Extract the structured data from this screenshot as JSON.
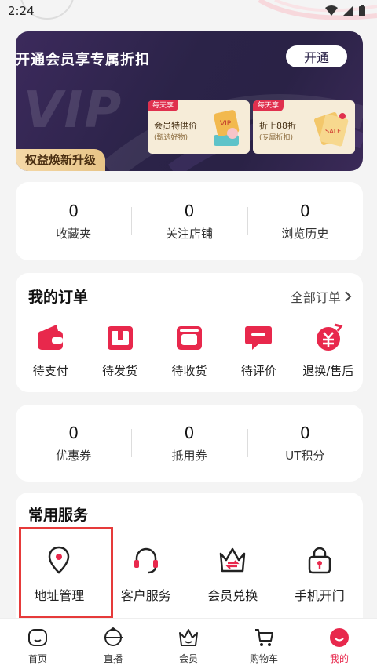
{
  "status_bar": {
    "time": "2:24"
  },
  "vip": {
    "title": "开通会员享专属折扣",
    "open_button": "开通",
    "watermark": "VIP",
    "benefits": [
      {
        "tag": "每天享",
        "main": "会员特供价",
        "sub": "(甄选好物)"
      },
      {
        "tag": "每天享",
        "main": "折上88折",
        "sub": "(专属折扣)"
      }
    ],
    "upgrade_label": "权益焕新升级"
  },
  "stats_top": [
    {
      "value": "0",
      "label": "收藏夹"
    },
    {
      "value": "0",
      "label": "关注店铺"
    },
    {
      "value": "0",
      "label": "浏览历史"
    }
  ],
  "orders": {
    "title": "我的订单",
    "all_label": "全部订单",
    "items": [
      {
        "label": "待支付",
        "icon": "wallet-icon"
      },
      {
        "label": "待发货",
        "icon": "box-icon"
      },
      {
        "label": "待收货",
        "icon": "package-icon"
      },
      {
        "label": "待评价",
        "icon": "comment-icon"
      },
      {
        "label": "退换/售后",
        "icon": "refund-icon"
      }
    ]
  },
  "stats_assets": [
    {
      "value": "0",
      "label": "优惠券"
    },
    {
      "value": "0",
      "label": "抵用券"
    },
    {
      "value": "0",
      "label": "UT积分"
    }
  ],
  "services": {
    "title": "常用服务",
    "items": [
      {
        "label": "地址管理",
        "icon": "location-pin-icon"
      },
      {
        "label": "客户服务",
        "icon": "headset-icon"
      },
      {
        "label": "会员兑换",
        "icon": "crown-exchange-icon"
      },
      {
        "label": "手机开门",
        "icon": "lock-icon"
      }
    ]
  },
  "bottom_nav": [
    {
      "label": "首页",
      "icon": "home-icon"
    },
    {
      "label": "直播",
      "icon": "live-icon"
    },
    {
      "label": "会员",
      "icon": "crown-icon"
    },
    {
      "label": "购物车",
      "icon": "cart-icon"
    },
    {
      "label": "我的",
      "icon": "profile-icon",
      "active": true
    }
  ],
  "colors": {
    "accent": "#e8284c",
    "highlight_box": "#e63a3a",
    "vip_bg": "#2b2348"
  }
}
